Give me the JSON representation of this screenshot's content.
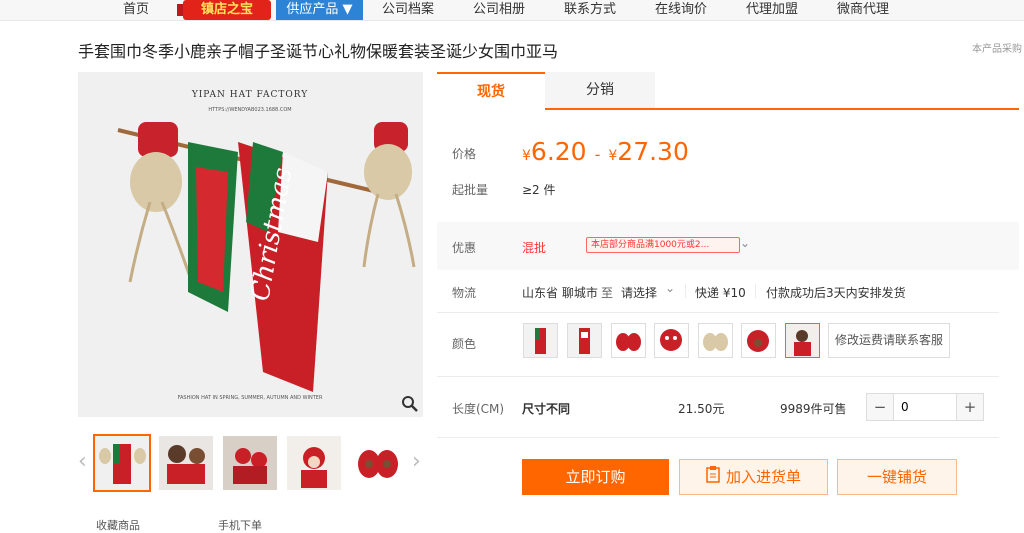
{
  "nav": {
    "items": [
      "首页",
      "公司档案",
      "公司相册",
      "联系方式",
      "在线询价",
      "代理加盟",
      "微商代理"
    ],
    "badge": "镇店之宝",
    "supply": "供应产品 ▼"
  },
  "product": {
    "title": "手套围巾冬季小鹿亲子帽子圣诞节心礼物保暖套装圣诞少女围巾亚马",
    "title_note": "本产品采购",
    "image_brand": "YIPAN HAT FACTORY",
    "image_url_text": "HTTPS://WENDYAB023.1688.COM",
    "image_caption": "FASHION HAT IN SPRING, SUMMER, AUTUMN AND WINTER"
  },
  "tabs": [
    "现货",
    "分销"
  ],
  "price": {
    "label": "价格",
    "currency": "¥",
    "min": "6.20",
    "max": "27.30",
    "moq_label": "起批量",
    "moq_value": "≥2 件"
  },
  "promo": {
    "label": "优惠",
    "type": "混批",
    "tag": "本店部分商品满1000元或2..."
  },
  "logistics": {
    "label": "物流",
    "from": "山东省 聊城市",
    "to_word": "至",
    "to_select": "请选择",
    "express": "快递 ¥10",
    "shipping": "付款成功后3天内安排发货"
  },
  "color": {
    "label": "颜色",
    "swatch_count": 7,
    "selected_index": 6,
    "extra": "修改运费请联系客服"
  },
  "spec": {
    "label": "长度(CM)",
    "value": "尺寸不同",
    "price": "21.50元",
    "stock": "9989件可售",
    "qty": "0",
    "minus": "−",
    "plus": "+"
  },
  "buttons": {
    "buy": "立即订购",
    "cart": "加入进货单",
    "dist": "一键铺货"
  },
  "bottom": {
    "left": "收藏商品",
    "right": "手机下单"
  },
  "colors": {
    "accent": "#ff6600",
    "nav_red": "#e2231a",
    "nav_blue": "#2d84d6"
  }
}
